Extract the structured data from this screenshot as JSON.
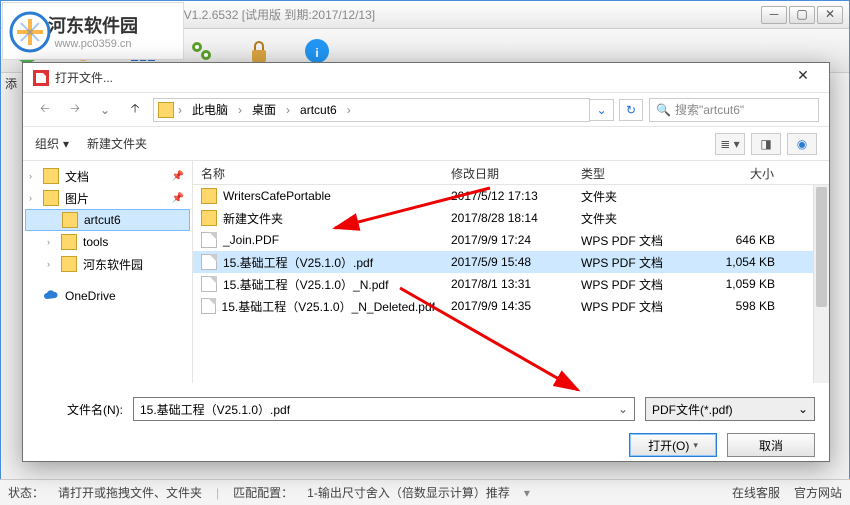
{
  "main": {
    "title": "乐闪软件-PDF尺寸统计助手_V1.2.6532 [试用版 到期:2017/12/13]",
    "toolbar_side_label": "添"
  },
  "logo": {
    "name": "河东软件园",
    "url": "www.pc0359.cn"
  },
  "status": {
    "label": "状态：",
    "hint": "请打开或拖拽文件、文件夹",
    "match": "匹配配置：",
    "rule": "1-输出尺寸舍入（倍数显示计算）推荐",
    "link1": "在线客服",
    "link2": "官方网站"
  },
  "dlg": {
    "title": "打开文件...",
    "crumbs": [
      "此电脑",
      "桌面",
      "artcut6"
    ],
    "search_placeholder": "搜索\"artcut6\"",
    "organize": "组织",
    "newfolder": "新建文件夹",
    "tree": [
      {
        "label": "文档",
        "pin": true
      },
      {
        "label": "图片",
        "pin": true
      },
      {
        "label": "artcut6",
        "selected": true,
        "indent": true
      },
      {
        "label": "tools",
        "indent": true
      },
      {
        "label": "河东软件园",
        "indent": true
      },
      {
        "label": "OneDrive",
        "onedrive": true
      }
    ],
    "columns": {
      "name": "名称",
      "date": "修改日期",
      "type": "类型",
      "size": "大小"
    },
    "rows": [
      {
        "name": "WritersCafePortable",
        "date": "2017/5/12 17:13",
        "type": "文件夹",
        "size": "",
        "folder": true
      },
      {
        "name": "新建文件夹",
        "date": "2017/8/28 18:14",
        "type": "文件夹",
        "size": "",
        "folder": true
      },
      {
        "name": "_Join.PDF",
        "date": "2017/9/9 17:24",
        "type": "WPS PDF 文档",
        "size": "646 KB"
      },
      {
        "name": "15.基础工程（V25.1.0）.pdf",
        "date": "2017/5/9 15:48",
        "type": "WPS PDF 文档",
        "size": "1,054 KB",
        "selected": true
      },
      {
        "name": "15.基础工程（V25.1.0）_N.pdf",
        "date": "2017/8/1 13:31",
        "type": "WPS PDF 文档",
        "size": "1,059 KB"
      },
      {
        "name": "15.基础工程（V25.1.0）_N_Deleted.pdf",
        "date": "2017/9/9 14:35",
        "type": "WPS PDF 文档",
        "size": "598 KB"
      }
    ],
    "filename_label": "文件名(N):",
    "filename_value": "15.基础工程（V25.1.0）.pdf",
    "filter": "PDF文件(*.pdf)",
    "open": "打开(O)",
    "cancel": "取消"
  }
}
